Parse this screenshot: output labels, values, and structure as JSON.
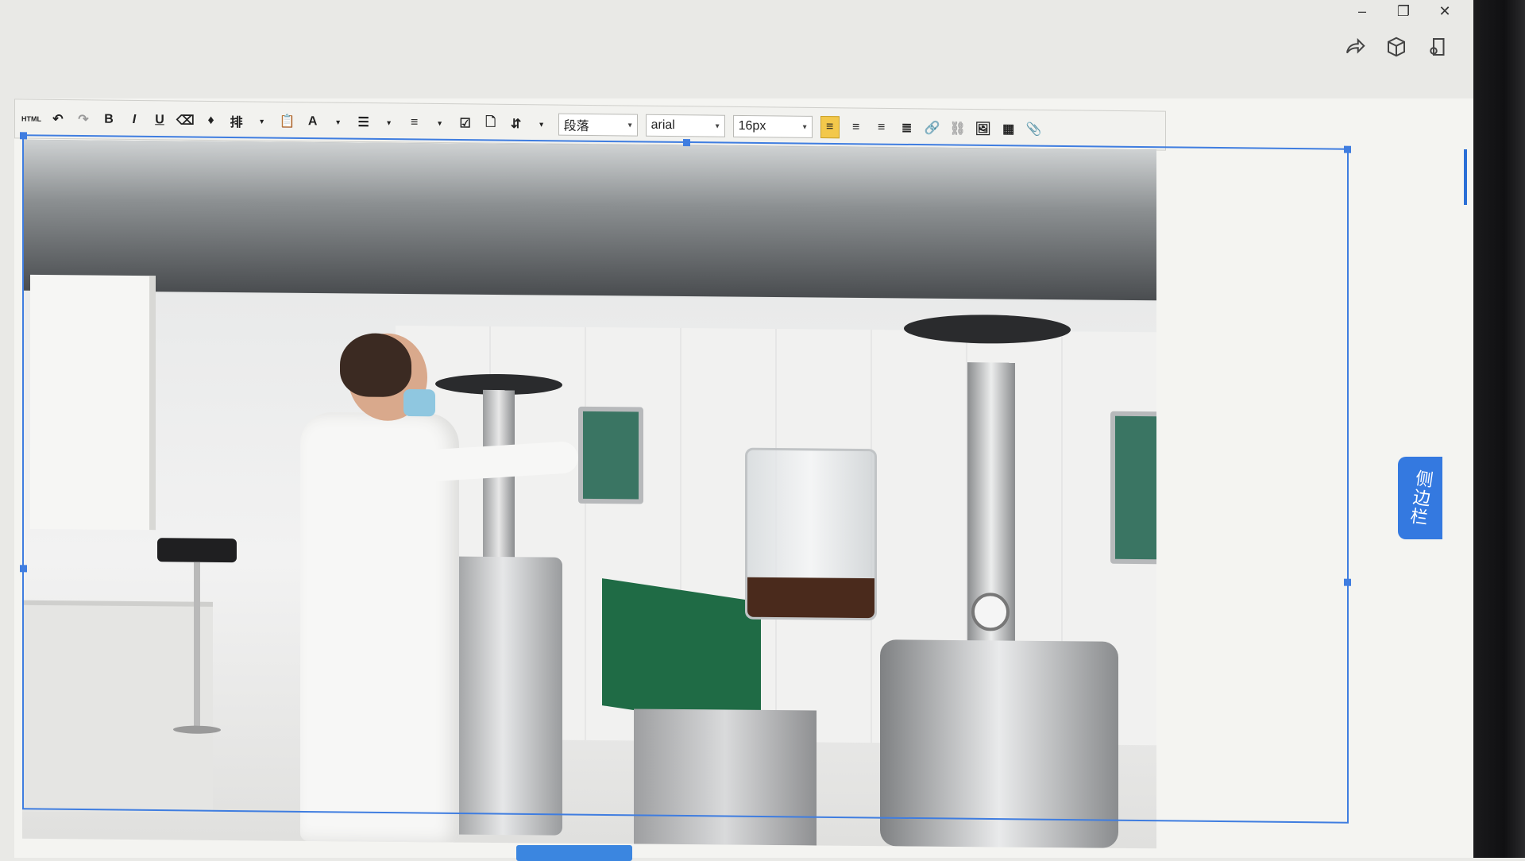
{
  "window": {
    "controls": {
      "minimize_icon": "minimize-icon",
      "restore_icon": "restore-icon",
      "close_icon": "close-icon"
    }
  },
  "top_actions": [
    "share-icon",
    "cube-icon",
    "note-icon"
  ],
  "toolbar": {
    "html_label": "HTML",
    "bold_label": "B",
    "italic_label": "I",
    "underline_label": "U",
    "typeset_label": "排",
    "font_color_label": "A",
    "paragraph_select": "段落",
    "font_family_select": "arial",
    "font_size_select": "16px"
  },
  "sidebar_tab": {
    "label": "侧边栏"
  },
  "colors": {
    "accent": "#3479e0",
    "toolbar_active": "#f3c84b",
    "selection_border": "#3f7de0"
  }
}
